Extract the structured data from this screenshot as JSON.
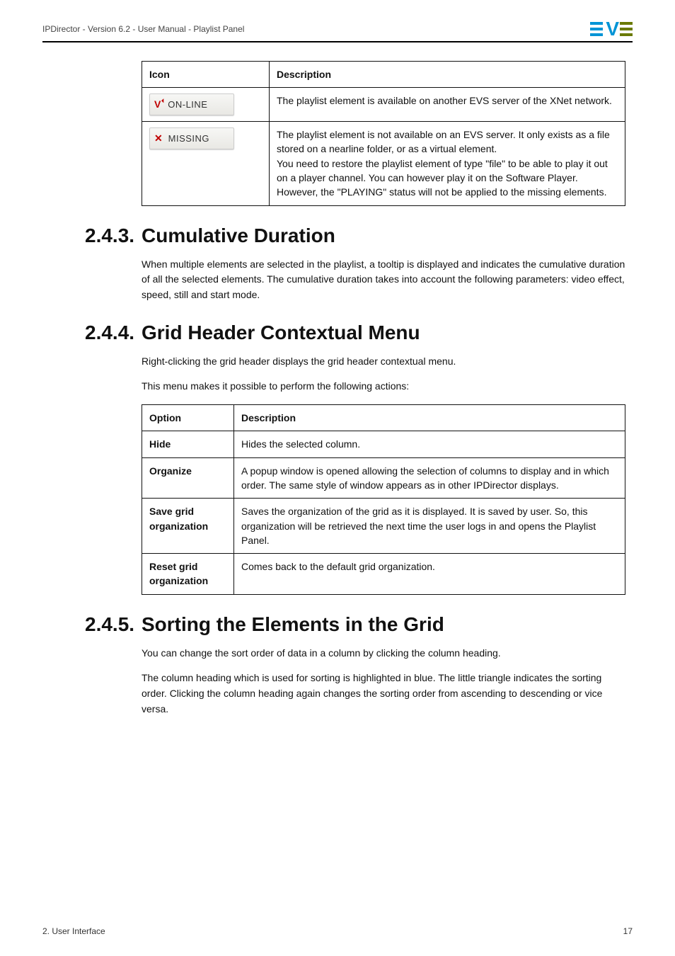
{
  "header": {
    "product_line": "IPDirector - Version 6.2 - User Manual - Playlist Panel"
  },
  "tables": {
    "icon_table": {
      "head": [
        "Icon",
        "Description"
      ],
      "rows": [
        {
          "icon_label": "ON-LINE",
          "desc": "The playlist element is available on another EVS server of the XNet network."
        },
        {
          "icon_label": "MISSING",
          "desc_l1": "The playlist element is not available on an EVS server. It only exists as a file stored on a nearline folder, or as a virtual element.",
          "desc_l2": "You need to restore the playlist element of type \"file\" to be able to play it out on a player channel. You can however play it on the Software Player. However, the \"PLAYING\" status will not be applied to the missing elements."
        }
      ]
    },
    "option_table": {
      "head": [
        "Option",
        "Description"
      ],
      "rows": [
        {
          "opt": "Hide",
          "desc": "Hides the selected column."
        },
        {
          "opt": "Organize",
          "desc": "A popup window is opened allowing the selection of columns to display and in which order. The same style of window appears as in other IPDirector displays."
        },
        {
          "opt": "Save grid organization",
          "desc": "Saves the organization of the grid as it is displayed. It is saved by user. So, this organization will be retrieved the next time the user logs in and opens the Playlist Panel."
        },
        {
          "opt": "Reset grid organization",
          "desc": "Comes back to the default grid organization."
        }
      ]
    }
  },
  "sections": {
    "s243": {
      "num": "2.4.3.",
      "title": "Cumulative Duration",
      "body": "When multiple elements are selected in the playlist, a tooltip is displayed and indicates the cumulative duration of all the selected elements. The cumulative duration takes into account the following parameters: video effect, speed, still and start mode."
    },
    "s244": {
      "num": "2.4.4.",
      "title": "Grid Header Contextual Menu",
      "lead1": "Right-clicking the grid header displays the grid header contextual menu.",
      "lead2": "This menu makes it possible to perform the following actions:"
    },
    "s245": {
      "num": "2.4.5.",
      "title": "Sorting the Elements in the Grid",
      "p1": "You can change the sort order of data in a column by clicking the column heading.",
      "p2": "The column heading which is used for sorting is highlighted in blue. The little triangle indicates the sorting order. Clicking the column heading again changes the sorting order from ascending to descending or vice versa."
    }
  },
  "footer": {
    "left": "2. User Interface",
    "right": "17"
  }
}
